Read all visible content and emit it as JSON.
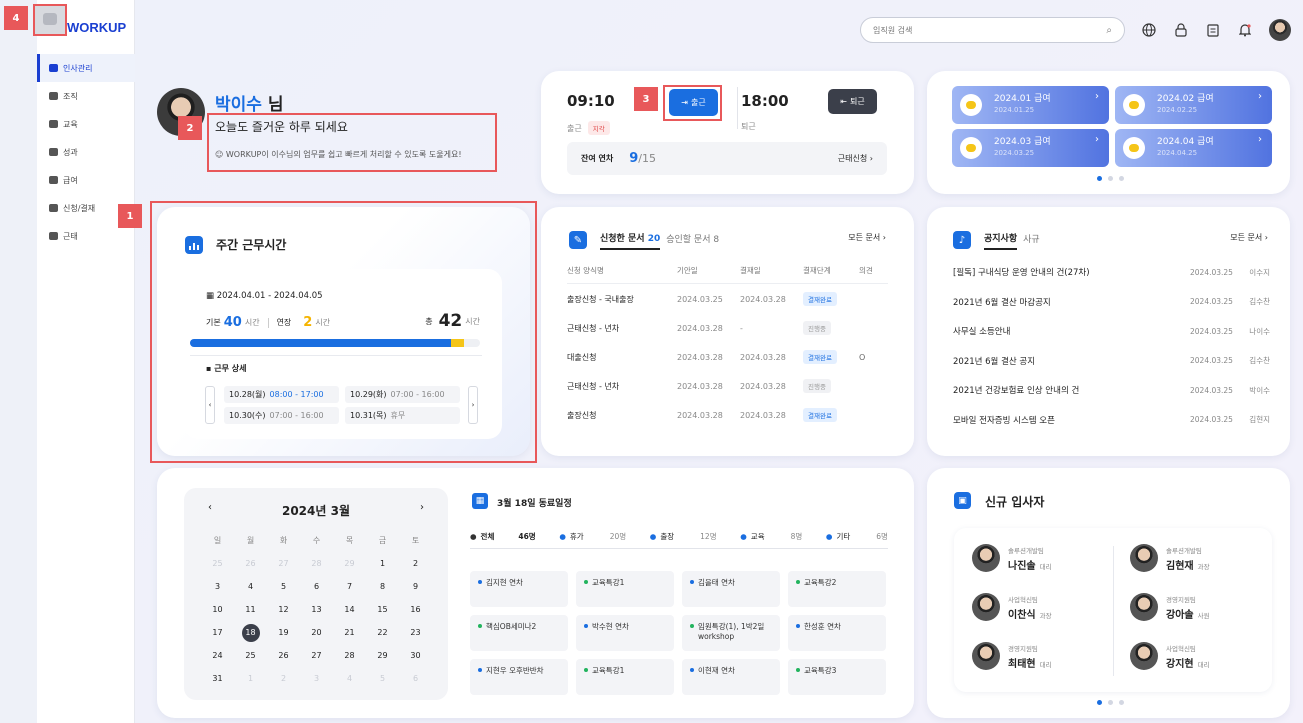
{
  "app": {
    "logo": "WORKUP"
  },
  "sidebar": {
    "items": [
      {
        "label": "인사관리",
        "icon": "person-card-icon",
        "active": true
      },
      {
        "label": "조직",
        "icon": "people-icon"
      },
      {
        "label": "교육",
        "icon": "graduation-cap-icon"
      },
      {
        "label": "성과",
        "icon": "trophy-icon"
      },
      {
        "label": "급여",
        "icon": "money-icon"
      },
      {
        "label": "신청/결재",
        "icon": "briefcase-icon"
      },
      {
        "label": "근태",
        "icon": "check-calendar-icon"
      }
    ]
  },
  "topbar": {
    "search_placeholder": "임직원 검색",
    "icons": [
      "globe-icon",
      "lock-icon",
      "clipboard-icon",
      "bell-icon",
      "user-avatar"
    ]
  },
  "annotations": [
    "1",
    "2",
    "3",
    "4"
  ],
  "profile": {
    "name": "박이수",
    "suffix": "님",
    "greeting": "오늘도 즐거운 하루 되세요",
    "note": "WORKUP이 이수님의 업무를 쉽고 빠르게 처리할 수 있도록 도울게요!"
  },
  "attendance": {
    "in_time": "09:10",
    "in_label": "출근",
    "late_badge": "지각",
    "in_button": "출근",
    "out_time": "18:00",
    "out_label": "퇴근",
    "out_button": "퇴근",
    "leave_label": "잔여 연차",
    "leave_used": "9",
    "leave_total": "/15",
    "leave_link": "근태신청"
  },
  "salary": {
    "items": [
      {
        "title": "2024.01 급여",
        "date": "2024.01.25"
      },
      {
        "title": "2024.02 급여",
        "date": "2024.02.25"
      },
      {
        "title": "2024.03 급여",
        "date": "2024.03.25"
      },
      {
        "title": "2024.04 급여",
        "date": "2024.04.25"
      }
    ]
  },
  "weekly": {
    "title": "주간 근무시간",
    "range": "2024.04.01 - 2024.04.05",
    "base_label": "기본",
    "base_value": "40",
    "base_unit": "시간",
    "ext_label": "연장",
    "ext_value": "2",
    "ext_unit": "시간",
    "total_label": "총",
    "total_value": "42",
    "total_unit": "시간",
    "base_fraction": 0.9,
    "ext_fraction": 0.045,
    "detail_label": "근무 상세",
    "days": [
      {
        "day": "10.28(월)",
        "time": "08:00 - 17:00",
        "highlight": true
      },
      {
        "day": "10.29(화)",
        "time": "07:00 - 16:00"
      },
      {
        "day": "10.30(수)",
        "time": "07:00 - 16:00"
      },
      {
        "day": "10.31(목)",
        "time": "휴무"
      }
    ]
  },
  "documents": {
    "tab_requested": "신청한 문서",
    "tab_requested_count": "20",
    "tab_approve": "승인할 문서",
    "tab_approve_count": "8",
    "all_link": "모든 문서",
    "headers": [
      "신청 양식명",
      "기안일",
      "결재일",
      "결재단계",
      "의견"
    ],
    "rows": [
      {
        "name": "출장신청 - 국내출장",
        "draft": "2024.03.25",
        "approve": "2024.03.28",
        "status": "결재완료",
        "done": true,
        "opinion": ""
      },
      {
        "name": "근태신청 - 년차",
        "draft": "2024.03.28",
        "approve": "-",
        "status": "진행중",
        "done": false,
        "opinion": ""
      },
      {
        "name": "대출신청",
        "draft": "2024.03.28",
        "approve": "2024.03.28",
        "status": "결재완료",
        "done": true,
        "opinion": "O"
      },
      {
        "name": "근태신청 - 년차",
        "draft": "2024.03.28",
        "approve": "2024.03.28",
        "status": "진행중",
        "done": false,
        "opinion": ""
      },
      {
        "name": "출장신청",
        "draft": "2024.03.28",
        "approve": "2024.03.28",
        "status": "결재완료",
        "done": true,
        "opinion": ""
      }
    ]
  },
  "notices": {
    "tab_notice": "공지사항",
    "tab_company": "사규",
    "all_link": "모든 문서",
    "rows": [
      {
        "title": "[필독] 구내식당 운영 안내의 건(27차)",
        "date": "2024.03.25",
        "author": "이수지"
      },
      {
        "title": "2021년 6월 결산 마감공지",
        "date": "2024.03.25",
        "author": "김수찬"
      },
      {
        "title": "사무실 소등안내",
        "date": "2024.03.25",
        "author": "나이수"
      },
      {
        "title": "2021년 6월 결산 공지",
        "date": "2024.03.25",
        "author": "김수찬"
      },
      {
        "title": "2021년 건강보험료 인상 안내의 건",
        "date": "2024.03.25",
        "author": "박이수"
      },
      {
        "title": "모바일 전자증빙 시스템 오픈",
        "date": "2024.03.25",
        "author": "김현지"
      }
    ]
  },
  "calendar": {
    "title": "2024년 3월",
    "prev": "‹",
    "next": "›",
    "weekdays": [
      "일",
      "월",
      "화",
      "수",
      "목",
      "금",
      "토"
    ],
    "cells": [
      {
        "d": "25",
        "m": true
      },
      {
        "d": "26",
        "m": true
      },
      {
        "d": "27",
        "m": true
      },
      {
        "d": "28",
        "m": true
      },
      {
        "d": "29",
        "m": true
      },
      {
        "d": "1"
      },
      {
        "d": "2"
      },
      {
        "d": "3"
      },
      {
        "d": "4"
      },
      {
        "d": "5"
      },
      {
        "d": "6"
      },
      {
        "d": "7"
      },
      {
        "d": "8"
      },
      {
        "d": "9"
      },
      {
        "d": "10"
      },
      {
        "d": "11"
      },
      {
        "d": "12"
      },
      {
        "d": "13"
      },
      {
        "d": "14"
      },
      {
        "d": "15"
      },
      {
        "d": "16"
      },
      {
        "d": "17"
      },
      {
        "d": "18",
        "today": true
      },
      {
        "d": "19"
      },
      {
        "d": "20"
      },
      {
        "d": "21"
      },
      {
        "d": "22"
      },
      {
        "d": "23"
      },
      {
        "d": "24"
      },
      {
        "d": "25"
      },
      {
        "d": "26"
      },
      {
        "d": "27"
      },
      {
        "d": "28"
      },
      {
        "d": "29"
      },
      {
        "d": "30"
      },
      {
        "d": "31"
      },
      {
        "d": "1",
        "m": true
      },
      {
        "d": "2",
        "m": true
      },
      {
        "d": "3",
        "m": true
      },
      {
        "d": "4",
        "m": true
      },
      {
        "d": "5",
        "m": true
      },
      {
        "d": "6",
        "m": true
      }
    ]
  },
  "schedule": {
    "title": "3월 18일 동료일정",
    "tabs": [
      {
        "label": "전체",
        "count": "46명",
        "icon": "people-icon"
      },
      {
        "label": "휴가",
        "count": "20명",
        "icon": "umbrella-icon"
      },
      {
        "label": "출장",
        "count": "12명",
        "icon": "bag-icon"
      },
      {
        "label": "교육",
        "count": "8명",
        "icon": "graduation-cap-icon"
      },
      {
        "label": "기타",
        "count": "6명",
        "icon": "grid-icon"
      }
    ],
    "events": [
      {
        "text": "김지현 연차",
        "color": "#1a6ee0"
      },
      {
        "text": "교육특강1",
        "color": "#22b35e"
      },
      {
        "text": "김을태 연차",
        "color": "#1a6ee0"
      },
      {
        "text": "교육특강2",
        "color": "#22b35e"
      },
      {
        "text": "핵심OB세미나2",
        "color": "#22b35e"
      },
      {
        "text": "박수현 연차",
        "color": "#1a6ee0"
      },
      {
        "text": "임원특강(1), 1박2일 workshop",
        "color": "#22b35e"
      },
      {
        "text": "한성훈 연차",
        "color": "#1a6ee0"
      },
      {
        "text": "지현우 오후반반차",
        "color": "#1a6ee0"
      },
      {
        "text": "교육특강1",
        "color": "#22b35e"
      },
      {
        "text": "이현재 연차",
        "color": "#1a6ee0"
      },
      {
        "text": "교육특강3",
        "color": "#22b35e"
      }
    ]
  },
  "new_hires": {
    "title": "신규 입사자",
    "people": [
      {
        "dept": "솔루션개발팀",
        "name": "나진솔",
        "rank": "대리"
      },
      {
        "dept": "솔루션개발팀",
        "name": "김현재",
        "rank": "과장"
      },
      {
        "dept": "사업혁신팀",
        "name": "이찬식",
        "rank": "과장"
      },
      {
        "dept": "경영지원팀",
        "name": "강아솔",
        "rank": "사원"
      },
      {
        "dept": "경영지원팀",
        "name": "최태현",
        "rank": "대리"
      },
      {
        "dept": "사업혁신팀",
        "name": "강지현",
        "rank": "대리"
      }
    ]
  }
}
